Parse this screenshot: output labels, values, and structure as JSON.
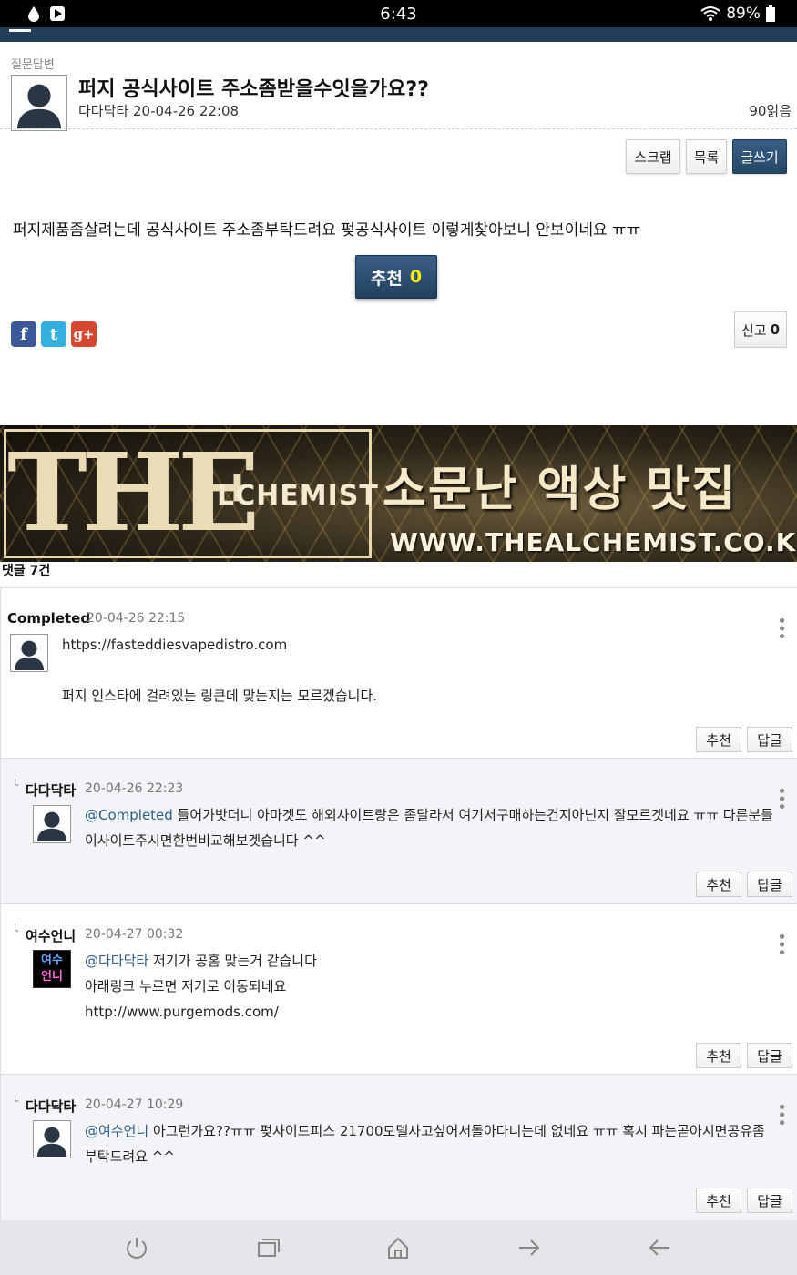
{
  "statusbar": {
    "time": "6:43",
    "battery": "89%",
    "icons": [
      "drop-icon",
      "play-store-icon",
      "wifi-icon",
      "battery-icon"
    ]
  },
  "post": {
    "category": "질문답변",
    "title": "퍼지 공식사이트 주소좀받을수잇을가요??",
    "author": "다다닥타",
    "date": "20-04-26 22:08",
    "views": "90읽음",
    "body": "퍼지제품좀살려는데 공식사이트 주소좀부탁드려요 펒공식사이트 이렇게찾아보니 안보이네요 ㅠㅠ",
    "buttons": {
      "scrap": "스크랩",
      "list": "목록",
      "write": "글쓰기"
    },
    "recommend_label": "추천",
    "recommend_count": "0",
    "report_label": "신고",
    "report_count": "0"
  },
  "banner": {
    "logo_text": "THE",
    "logo_sub": "LCHEMIST",
    "slogan": "소문난 액상 맛집",
    "url": "WWW.THEALCHEMIST.CO.KR"
  },
  "comments_header": "댓글 7건",
  "comments": [
    {
      "name": "Completed",
      "date": "20-04-26 22:15",
      "lines": [
        "https://fasteddiesvapedistro.com",
        "퍼지 인스타에 걸려있는 링큰데 맞는지는 모르겠습니다."
      ],
      "recommend": "추천",
      "reply": "답글"
    },
    {
      "name": "다다닥타",
      "date": "20-04-26 22:23",
      "mention": "@Completed",
      "line1": "들어가밧더니 아마겟도 해외사이트랑은 좀달라서 여기서구매하는건지아닌지 잘모르겟네요 ㅠㅠ 다른분들",
      "line2": "이사이트주시면한번비교해보겟습니다 ^^",
      "recommend": "추천",
      "reply": "답글"
    },
    {
      "name": "여수언니",
      "date": "20-04-27 00:32",
      "avatar_text": [
        "여수",
        "언니"
      ],
      "mention": "@다다닥타",
      "line1": "저기가 공홈 맞는거 같습니다",
      "line2": "아래링크 누르면 저기로 이동되네요",
      "line3": "http://www.purgemods.com/",
      "recommend": "추천",
      "reply": "답글"
    },
    {
      "name": "다다닥타",
      "date": "20-04-27 10:29",
      "mention": "@여수언니",
      "line1": "아그런가요??ㅠㅠ 펒사이드피스 21700모델사고싶어서돌아다니는데 없네요 ㅠㅠ 혹시 파는곧아시면공유좀",
      "line2": "부탁드려요 ^^",
      "recommend": "추천",
      "reply": "답글"
    }
  ],
  "navbar": {
    "icons": [
      "power-icon",
      "recent-apps-icon",
      "home-icon",
      "forward-icon",
      "back-icon"
    ]
  }
}
